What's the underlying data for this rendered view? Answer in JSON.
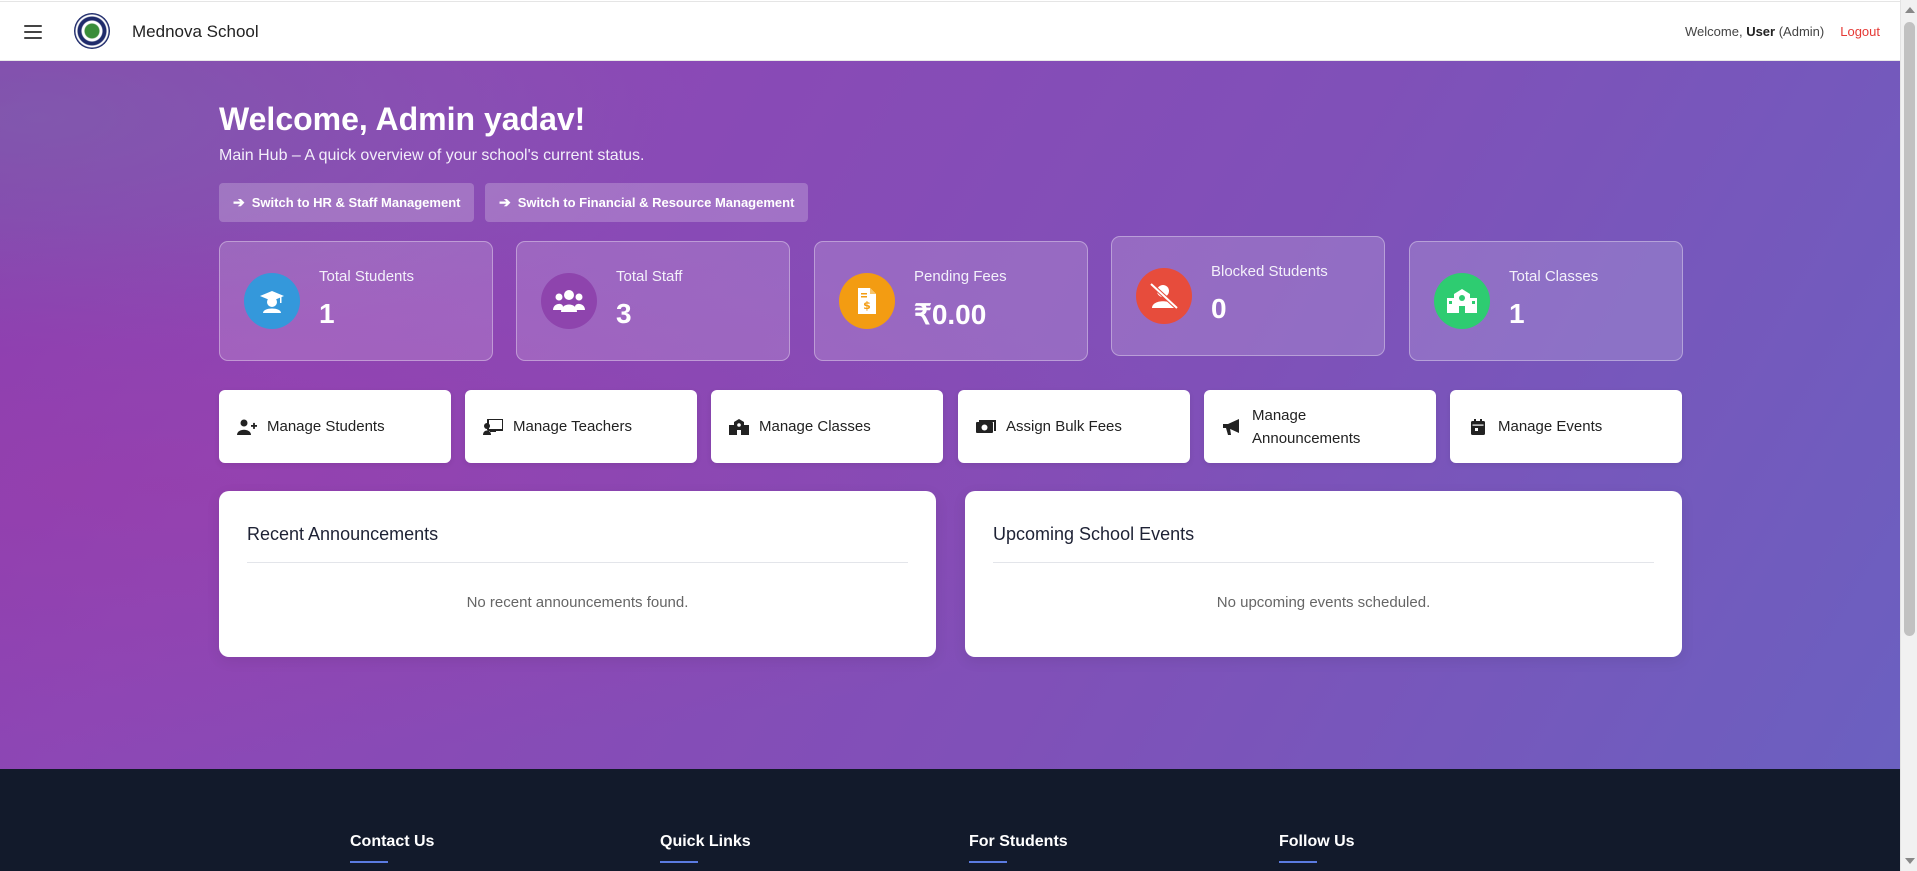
{
  "navbar": {
    "brand": "Mednova School",
    "welcome_prefix": "Welcome, ",
    "user_name": "User",
    "user_role": " (Admin)",
    "logout_label": "Logout"
  },
  "hero": {
    "welcome": "Welcome, Admin yadav!",
    "subtitle": "Main Hub – A quick overview of your school's current status.",
    "switch_hr": "Switch to HR & Staff Management",
    "switch_finance": "Switch to Financial & Resource Management"
  },
  "stats": [
    {
      "label": "Total Students",
      "value": "1",
      "icon": "graduate-icon",
      "color": "#3498db"
    },
    {
      "label": "Total Staff",
      "value": "3",
      "icon": "users-icon",
      "color": "#8e44ad"
    },
    {
      "label": "Pending Fees",
      "value": "₹0.00",
      "icon": "invoice-dollar-icon",
      "color": "#f39c12"
    },
    {
      "label": "Blocked Students",
      "value": "0",
      "icon": "user-slash-icon",
      "color": "#e74c3c"
    },
    {
      "label": "Total Classes",
      "value": "1",
      "icon": "school-icon",
      "color": "#2ecc71"
    }
  ],
  "actions": [
    {
      "label": "Manage Students",
      "icon": "user-plus-icon"
    },
    {
      "label": "Manage Teachers",
      "icon": "chalkboard-teacher-icon"
    },
    {
      "label": "Manage Classes",
      "icon": "school-building-icon"
    },
    {
      "label": "Assign Bulk Fees",
      "icon": "money-bill-icon"
    },
    {
      "label": "Manage Announcements",
      "icon": "bullhorn-icon"
    },
    {
      "label": "Manage Events",
      "icon": "calendar-icon"
    }
  ],
  "panels": {
    "announcements": {
      "title": "Recent Announcements",
      "empty": "No recent announcements found."
    },
    "events": {
      "title": "Upcoming School Events",
      "empty": "No upcoming events scheduled."
    }
  },
  "footer": {
    "columns": [
      "Contact Us",
      "Quick Links",
      "For Students",
      "Follow Us"
    ]
  }
}
